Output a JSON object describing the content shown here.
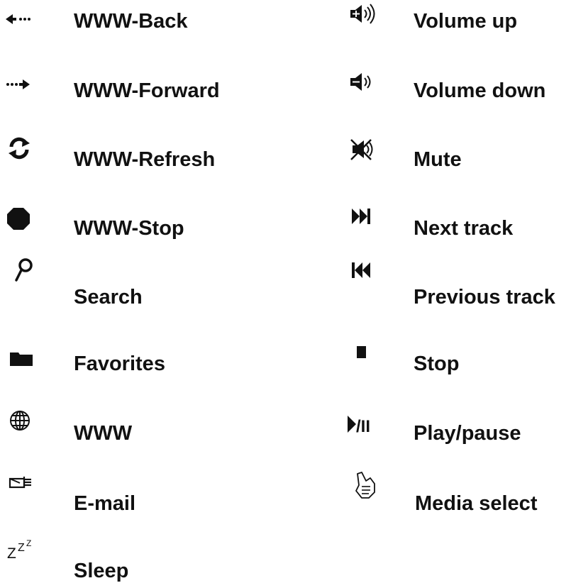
{
  "left_column": [
    {
      "icon": "www-back-icon",
      "label": "WWW-Back"
    },
    {
      "icon": "www-forward-icon",
      "label": "WWW-Forward"
    },
    {
      "icon": "www-refresh-icon",
      "label": "WWW-Refresh"
    },
    {
      "icon": "www-stop-icon",
      "label": "WWW-Stop"
    },
    {
      "icon": "search-icon",
      "label": "Search"
    },
    {
      "icon": "favorites-folder-icon",
      "label": "Favorites"
    },
    {
      "icon": "www-globe-icon",
      "label": "WWW"
    },
    {
      "icon": "email-icon",
      "label": "E-mail"
    },
    {
      "icon": "sleep-icon",
      "label": "Sleep",
      "glyph": "ZZZ"
    }
  ],
  "right_column": [
    {
      "icon": "volume-up-icon",
      "label": "Volume up"
    },
    {
      "icon": "volume-down-icon",
      "label": "Volume down"
    },
    {
      "icon": "mute-icon",
      "label": "Mute"
    },
    {
      "icon": "next-track-icon",
      "label": "Next track"
    },
    {
      "icon": "previous-track-icon",
      "label": "Previous track"
    },
    {
      "icon": "stop-icon",
      "label": "Stop"
    },
    {
      "icon": "play-pause-icon",
      "label": "Play/pause",
      "glyph": "/II"
    },
    {
      "icon": "media-select-icon",
      "label": "Media select"
    }
  ],
  "colors": {
    "ink": "#111111",
    "background": "#ffffff"
  }
}
